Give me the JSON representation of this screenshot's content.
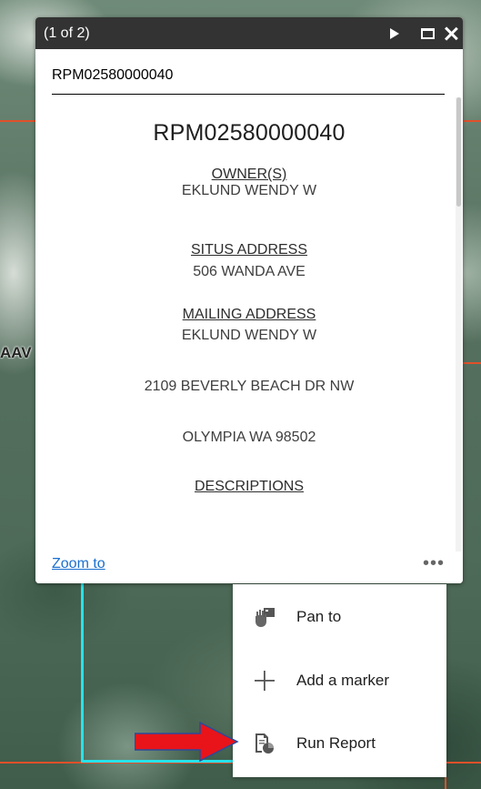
{
  "map": {
    "street_label": "AAV"
  },
  "popup": {
    "pager": "(1 of 2)",
    "title": "RPM02580000040",
    "content": {
      "heading": "RPM02580000040",
      "owner_label": "OWNER(S)",
      "owner_value": "EKLUND WENDY W",
      "situs_label": "SITUS ADDRESS",
      "situs_value": "506 WANDA AVE",
      "mailing_label": "MAILING ADDRESS",
      "mailing_line1": "EKLUND WENDY W",
      "mailing_line2": "2109 BEVERLY BEACH DR NW",
      "mailing_line3": "OLYMPIA WA 98502",
      "descriptions_label": "DESCRIPTIONS"
    },
    "footer": {
      "zoom_to": "Zoom to",
      "more": "•••"
    }
  },
  "menu": {
    "items": [
      {
        "label": "Pan to",
        "icon": "pan-icon"
      },
      {
        "label": "Add a marker",
        "icon": "plus-icon"
      },
      {
        "label": "Run Report",
        "icon": "report-icon"
      }
    ]
  },
  "colors": {
    "parcel_red": "#e0502a",
    "parcel_cyan": "#27e3ea",
    "link": "#1a6fcf",
    "header_bg": "#333333",
    "arrow": "#e8141a"
  }
}
